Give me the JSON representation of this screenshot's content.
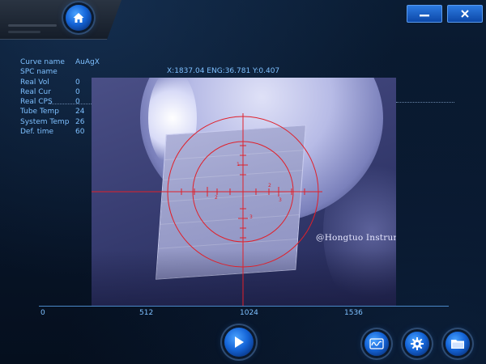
{
  "window": {
    "home_icon": "home-icon",
    "minimize_icon": "minimize-icon",
    "close_icon": "close-icon",
    "accent_color": "#1e6fe0"
  },
  "info": {
    "rows": [
      {
        "label": "Curve name",
        "value": "AuAgX"
      },
      {
        "label": "SPC name",
        "value": ""
      },
      {
        "label": "Real Vol",
        "value": "0"
      },
      {
        "label": "Real Cur",
        "value": "0"
      },
      {
        "label": "Real CPS",
        "value": "0"
      },
      {
        "label": "Tube Temp",
        "value": "24"
      },
      {
        "label": "System Temp",
        "value": "26"
      },
      {
        "label": "Def. time",
        "value": "60"
      }
    ]
  },
  "camera": {
    "coordinate_readout": "X:1837.04 ENG:36.781 Y:0.407",
    "watermark": "@Hongtuo Instrument",
    "reticle_labels": [
      "1",
      "2",
      "2",
      "3",
      "3"
    ],
    "reticle_color": "#e0202a"
  },
  "spectrum_axis": {
    "ticks": [
      "0",
      "512",
      "1024",
      "1536"
    ]
  },
  "toolbar": {
    "play_icon": "play-icon",
    "spectrum_icon": "spectrum-wave-icon",
    "settings_icon": "gear-icon",
    "folder_icon": "folder-icon"
  }
}
